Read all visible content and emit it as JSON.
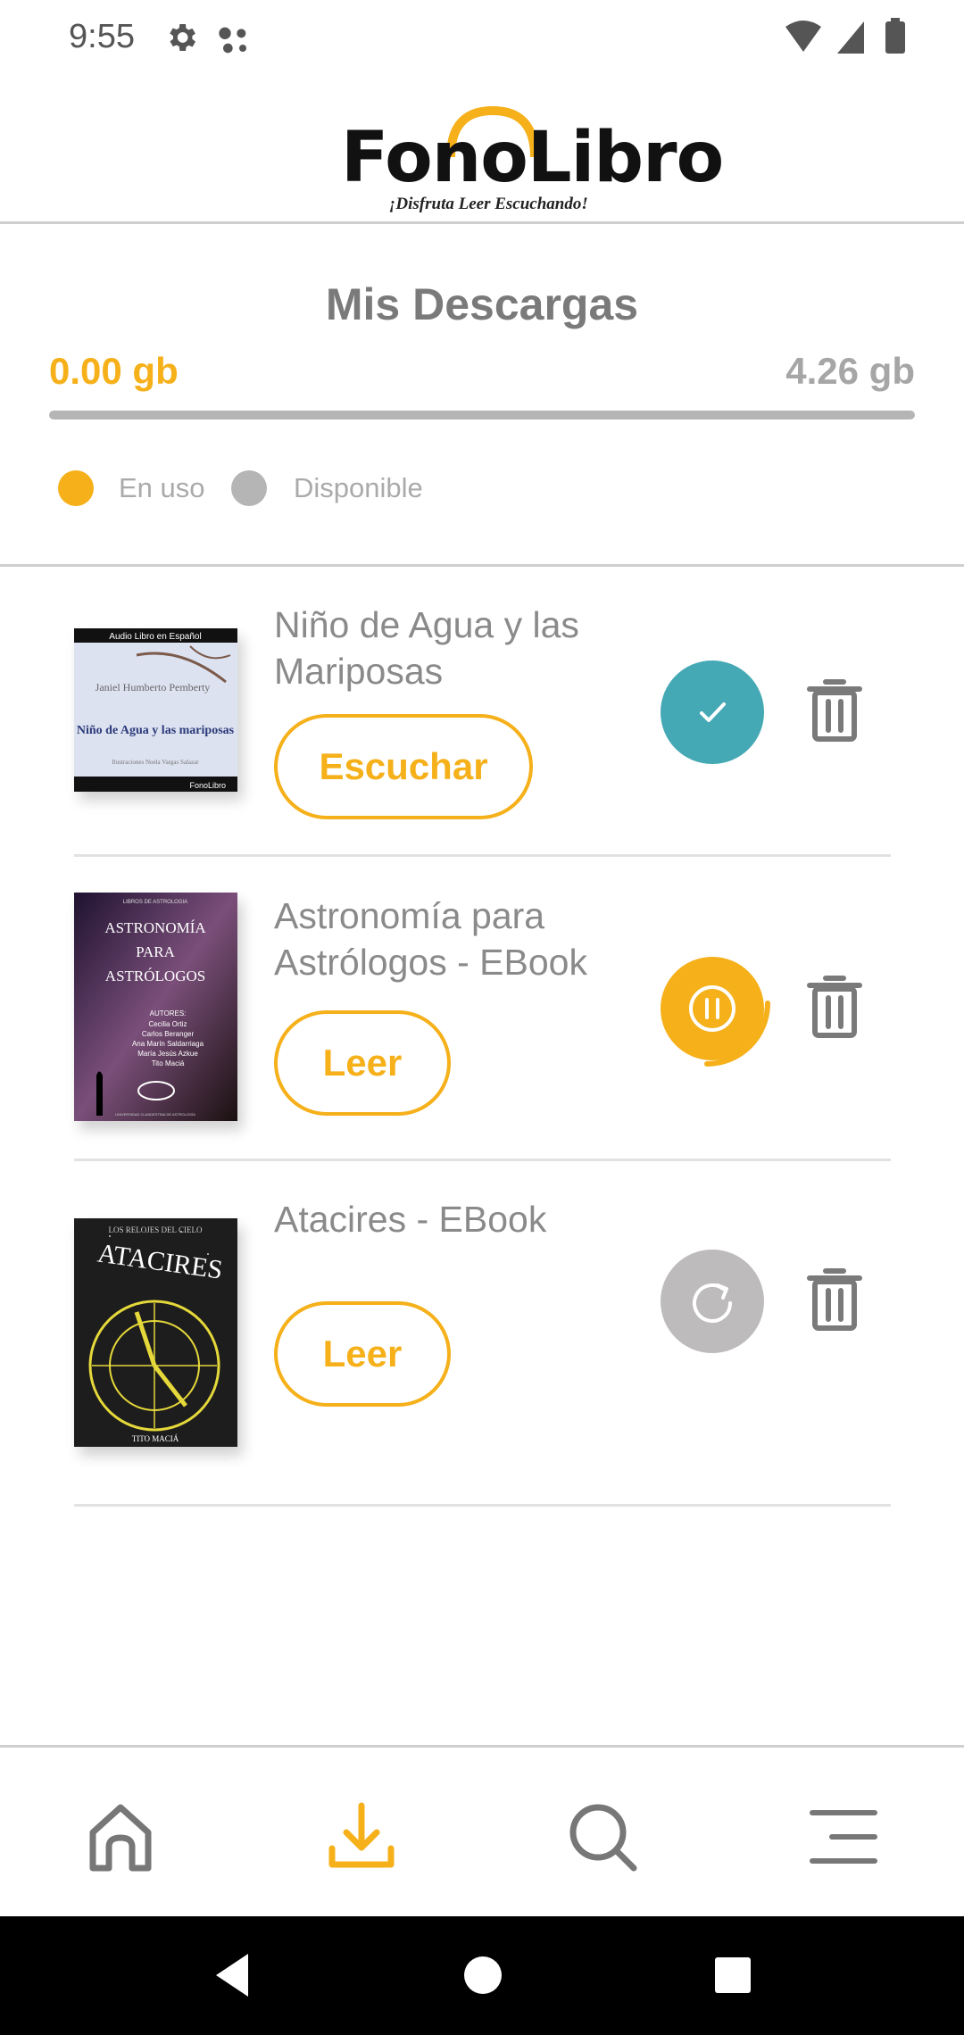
{
  "status_bar": {
    "time": "9:55",
    "icons": [
      "gear-icon",
      "assistant-dots-icon",
      "wifi-icon",
      "cell-signal-icon",
      "battery-icon"
    ]
  },
  "header": {
    "logo_text": "FonoLibro",
    "tagline": "¡Disfruta Leer Escuchando!"
  },
  "storage": {
    "title": "Mis Descargas",
    "used": "0.00 gb",
    "total": "4.26 gb",
    "used_fraction": 0.0,
    "legend": [
      {
        "label": "En uso",
        "color": "#f5b01a"
      },
      {
        "label": "Disponible",
        "color": "#b5b5b5"
      }
    ]
  },
  "downloads": [
    {
      "title": "Niño de Agua y las Mariposas",
      "action_label": "Escuchar",
      "status": "downloaded",
      "status_icon": "check-icon",
      "cover": {
        "top_text": "Audio Libro en Español",
        "author": "Janiel Humberto Pemberty",
        "book_title": "Niño de Agua y las mariposas",
        "illustrator": "Ilustraciones Noela Vargas Salazar",
        "brand": "FonoLibro"
      }
    },
    {
      "title": "Astronomía para Astrólogos - EBook",
      "action_label": "Leer",
      "status": "downloading",
      "status_icon": "pause-icon",
      "cover": {
        "top_text": "LIBROS DE ASTROLOGIA",
        "book_title": "ASTRONOMÍA PARA ASTRÓLOGOS",
        "authors_label": "AUTORES:",
        "authors": [
          "Cecilia Ortiz",
          "Carlos Beranger",
          "Ana Marín Saldarriaga",
          "María Jesús Azkue",
          "Tito Maciá"
        ],
        "footer": "UNIVERSIDAD CLANDESTINA DE ASTROLOGÍA"
      }
    },
    {
      "title": "Atacires - EBook",
      "action_label": "Leer",
      "status": "retry",
      "status_icon": "refresh-icon",
      "cover": {
        "top_text": "LOS RELOJES DEL CIELO",
        "book_title": "ATACIRES",
        "author": "TITO MACIÁ"
      }
    }
  ],
  "bottom_nav": {
    "items": [
      {
        "name": "home",
        "icon": "home-icon",
        "active": false
      },
      {
        "name": "downloads",
        "icon": "download-icon",
        "active": true
      },
      {
        "name": "search",
        "icon": "search-icon",
        "active": false
      },
      {
        "name": "menu",
        "icon": "menu-icon",
        "active": false
      }
    ],
    "active_color": "#f5b01a",
    "inactive_color": "#777777"
  },
  "colors": {
    "accent": "#f5b01a",
    "downloaded": "#45a9b5",
    "retry": "#bdbbbb",
    "text_muted": "#8a8a8a"
  }
}
